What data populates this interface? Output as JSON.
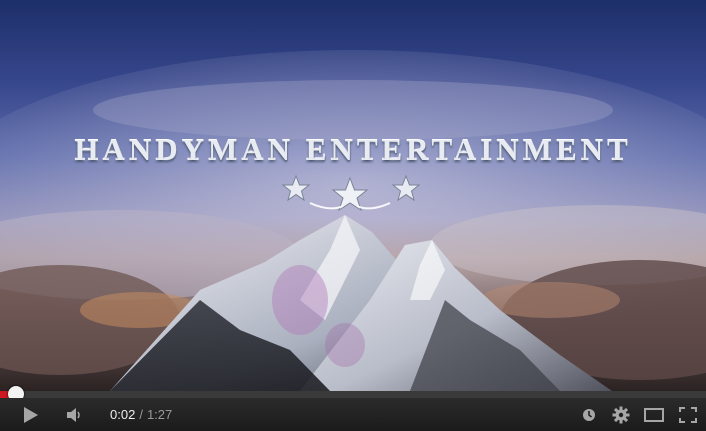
{
  "video": {
    "title_overlay": "HANDYMAN ENTERTAINMENT",
    "star_count": 3
  },
  "controls": {
    "current_time": "0:02",
    "separator": "/",
    "duration": "1:27",
    "played_fraction": 0.023,
    "buffered_fraction": 0.03,
    "icons": [
      "play-icon",
      "volume-icon",
      "watch-later-icon",
      "settings-gear-icon",
      "theater-mode-icon",
      "fullscreen-icon"
    ]
  },
  "colors": {
    "progress_played": "#cc181e",
    "control_bar": "#1b1b1b",
    "time_current": "#eeeeee",
    "time_total": "#999999"
  }
}
